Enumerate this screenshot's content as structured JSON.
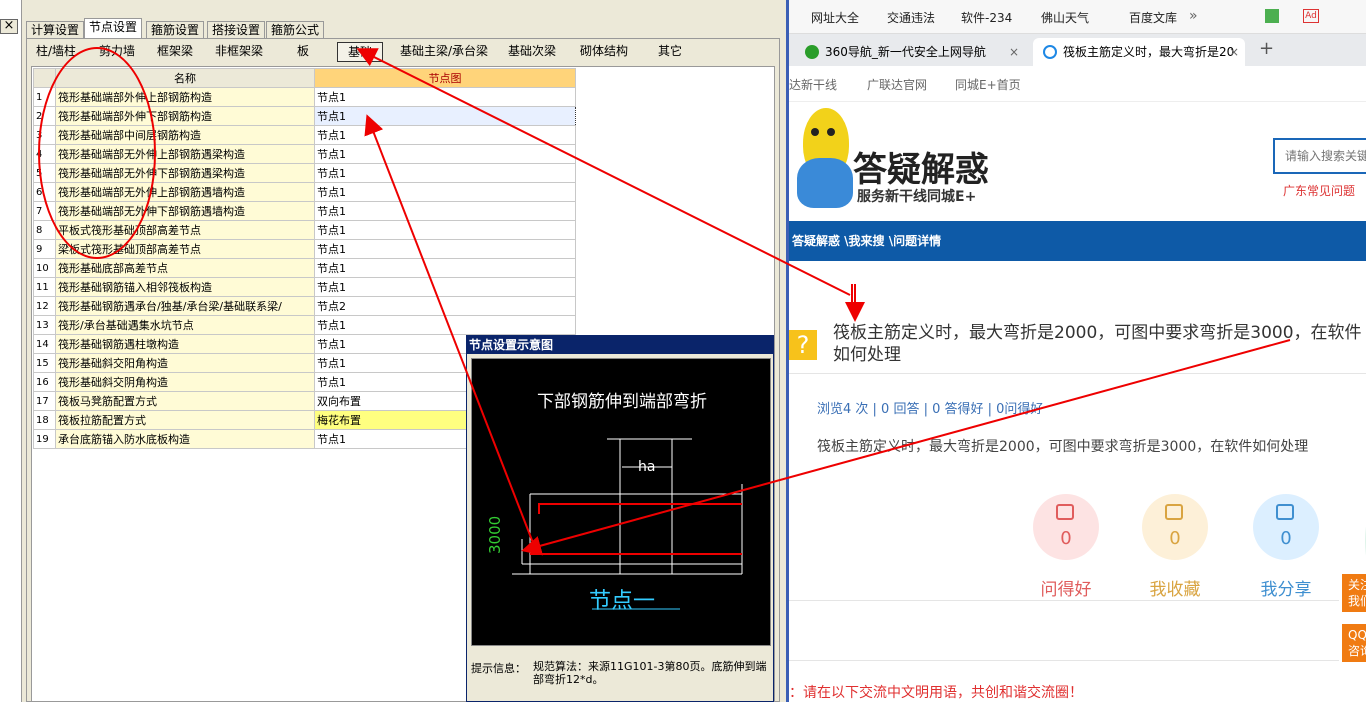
{
  "left_app": {
    "close_glyph": "×",
    "top_tabs": [
      "计算设置",
      "节点设置",
      "箍筋设置",
      "搭接设置",
      "箍筋公式"
    ],
    "active_top_tab": 1,
    "sub_tabs": [
      "柱/墙柱",
      "剪力墙",
      "框架梁",
      "非框架梁",
      "板",
      "基础",
      "基础主梁/承台梁",
      "基础次梁",
      "砌体结构",
      "其它"
    ],
    "active_sub_tab": 5,
    "grid": {
      "headers": [
        "名称",
        "节点图"
      ],
      "rows": [
        {
          "n": "1",
          "name": "筏形基础端部外伸上部钢筋构造",
          "node": "节点1"
        },
        {
          "n": "2",
          "name": "筏形基础端部外伸下部钢筋构造",
          "node": "节点1"
        },
        {
          "n": "3",
          "name": "筏形基础端部中间层钢筋构造",
          "node": "节点1"
        },
        {
          "n": "4",
          "name": "筏形基础端部无外伸上部钢筋遇梁构造",
          "node": "节点1"
        },
        {
          "n": "5",
          "name": "筏形基础端部无外伸下部钢筋遇梁构造",
          "node": "节点1"
        },
        {
          "n": "6",
          "name": "筏形基础端部无外伸上部钢筋遇墙构造",
          "node": "节点1"
        },
        {
          "n": "7",
          "name": "筏形基础端部无外伸下部钢筋遇墙构造",
          "node": "节点1"
        },
        {
          "n": "8",
          "name": "平板式筏形基础顶部高差节点",
          "node": "节点1"
        },
        {
          "n": "9",
          "name": "梁板式筏形基础顶部高差节点",
          "node": "节点1"
        },
        {
          "n": "10",
          "name": "筏形基础底部高差节点",
          "node": "节点1"
        },
        {
          "n": "11",
          "name": "筏形基础钢筋锚入相邻筏板构造",
          "node": "节点1"
        },
        {
          "n": "12",
          "name": "筏形基础钢筋遇承台/独基/承台梁/基础联系梁/",
          "node": "节点2"
        },
        {
          "n": "13",
          "name": "筏形/承台基础遇集水坑节点",
          "node": "节点1"
        },
        {
          "n": "14",
          "name": "筏形基础钢筋遇柱墩构造",
          "node": "节点1"
        },
        {
          "n": "15",
          "name": "筏形基础斜交阳角构造",
          "node": "节点1"
        },
        {
          "n": "16",
          "name": "筏形基础斜交阴角构造",
          "node": "节点1"
        },
        {
          "n": "17",
          "name": "筏板马凳筋配置方式",
          "node": "双向布置"
        },
        {
          "n": "18",
          "name": "筏板拉筋配置方式",
          "node": "梅花布置"
        },
        {
          "n": "19",
          "name": "承台底筋锚入防水底板构造",
          "node": "节点1"
        }
      ]
    },
    "popup": {
      "title": "节点设置示意图",
      "diagram_heading": "下部钢筋伸到端部弯折",
      "dim_ha": "ha",
      "dim_3000": "3000",
      "node_label": "节点一",
      "hint_label": "提示信息：",
      "hint_text": "规范算法：来源11G101-3第80页。底筋伸到端部弯折12*d。"
    }
  },
  "browser": {
    "bookmarks": [
      "网址大全",
      "交通违法",
      "软件-234",
      "佛山天气",
      "百度文库"
    ],
    "overflow": "»",
    "tabs": [
      "360导航_新一代安全上网导航",
      "筏板主筋定义时，最大弯折是20"
    ],
    "new_tab": "+",
    "links": [
      "达新干线",
      "广联达官网",
      "同城E+首页"
    ],
    "logo_title": "答疑解惑",
    "logo_sub": "服务新干线同城E+",
    "search_placeholder": "请输入搜索关键",
    "hot_link": "广东常见问题",
    "breadcrumb": "答疑解惑 \\我来搜 \\问题详情",
    "question_title": "筏板主筋定义时，最大弯折是2000，可图中要求弯折是3000，在软件如何处理",
    "stats": "浏览4 次 | 0 回答 | 0 答得好 | 0问得好",
    "question_body": "筏板主筋定义时，最大弯折是2000，可图中要求弯折是3000，在软件如何处理",
    "actions": [
      {
        "count": "0",
        "label": "问得好",
        "color": "#e05c5c",
        "bg": "#fde3e3"
      },
      {
        "count": "0",
        "label": "我收藏",
        "color": "#d9a441",
        "bg": "#fdf0d8"
      },
      {
        "count": "0",
        "label": "我分享",
        "color": "#3f8fd0",
        "bg": "#dcefff"
      }
    ],
    "side_btns": [
      "关注我们",
      "QQ咨询"
    ],
    "notice": "：请在以下交流中文明用语，共创和谐交流圈！"
  }
}
